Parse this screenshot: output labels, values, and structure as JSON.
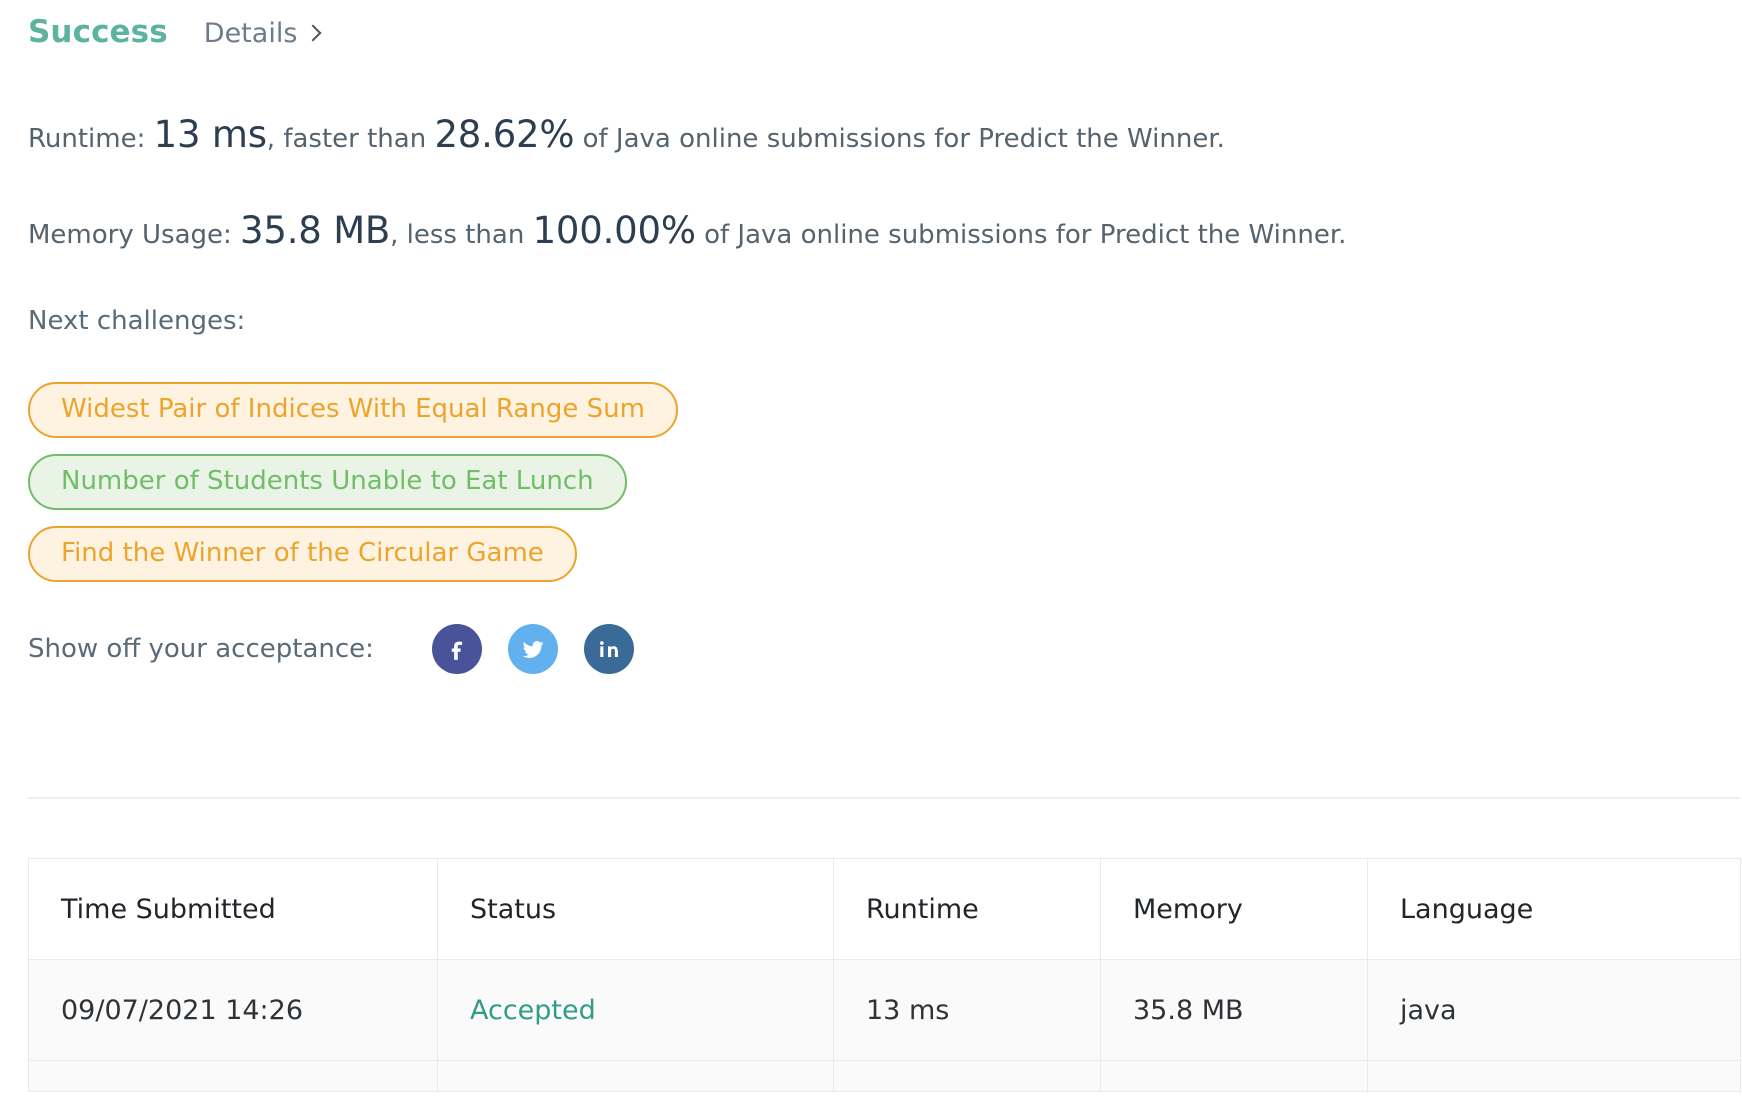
{
  "header": {
    "status": "Success",
    "details_label": "Details",
    "chevron_icon": "chevron-right-icon",
    "status_color": "#5cb3a0",
    "details_color": "#6c7c8c"
  },
  "runtime_line": {
    "prefix": "Runtime:",
    "value": "13 ms",
    "middle": ", faster than",
    "percent": "28.62%",
    "suffix": "of Java online submissions for Predict the Winner."
  },
  "memory_line": {
    "prefix": "Memory Usage:",
    "value": "35.8 MB",
    "middle": ", less than",
    "percent": "100.00%",
    "suffix": "of Java online submissions for Predict the Winner."
  },
  "next_challenges": {
    "label": "Next challenges:",
    "items": [
      {
        "title": "Widest Pair of Indices With Equal Range Sum",
        "tone": "amber",
        "color": "#eda42c"
      },
      {
        "title": "Number of Students Unable to Eat Lunch",
        "tone": "green",
        "color": "#72bd6a"
      },
      {
        "title": "Find the Winner of the Circular Game",
        "tone": "amber",
        "color": "#eda42c"
      }
    ]
  },
  "share": {
    "label": "Show off your acceptance:",
    "icons": [
      {
        "name": "facebook-icon",
        "color": "#49539a"
      },
      {
        "name": "twitter-icon",
        "color": "#62b0ed"
      },
      {
        "name": "linkedin-icon",
        "color": "#3a6a98"
      }
    ]
  },
  "submissions_table": {
    "columns": [
      "Time Submitted",
      "Status",
      "Runtime",
      "Memory",
      "Language"
    ],
    "rows": [
      {
        "time_submitted": "09/07/2021 14:26",
        "status": "Accepted",
        "runtime": "13 ms",
        "memory": "35.8 MB",
        "language": "java"
      }
    ]
  }
}
